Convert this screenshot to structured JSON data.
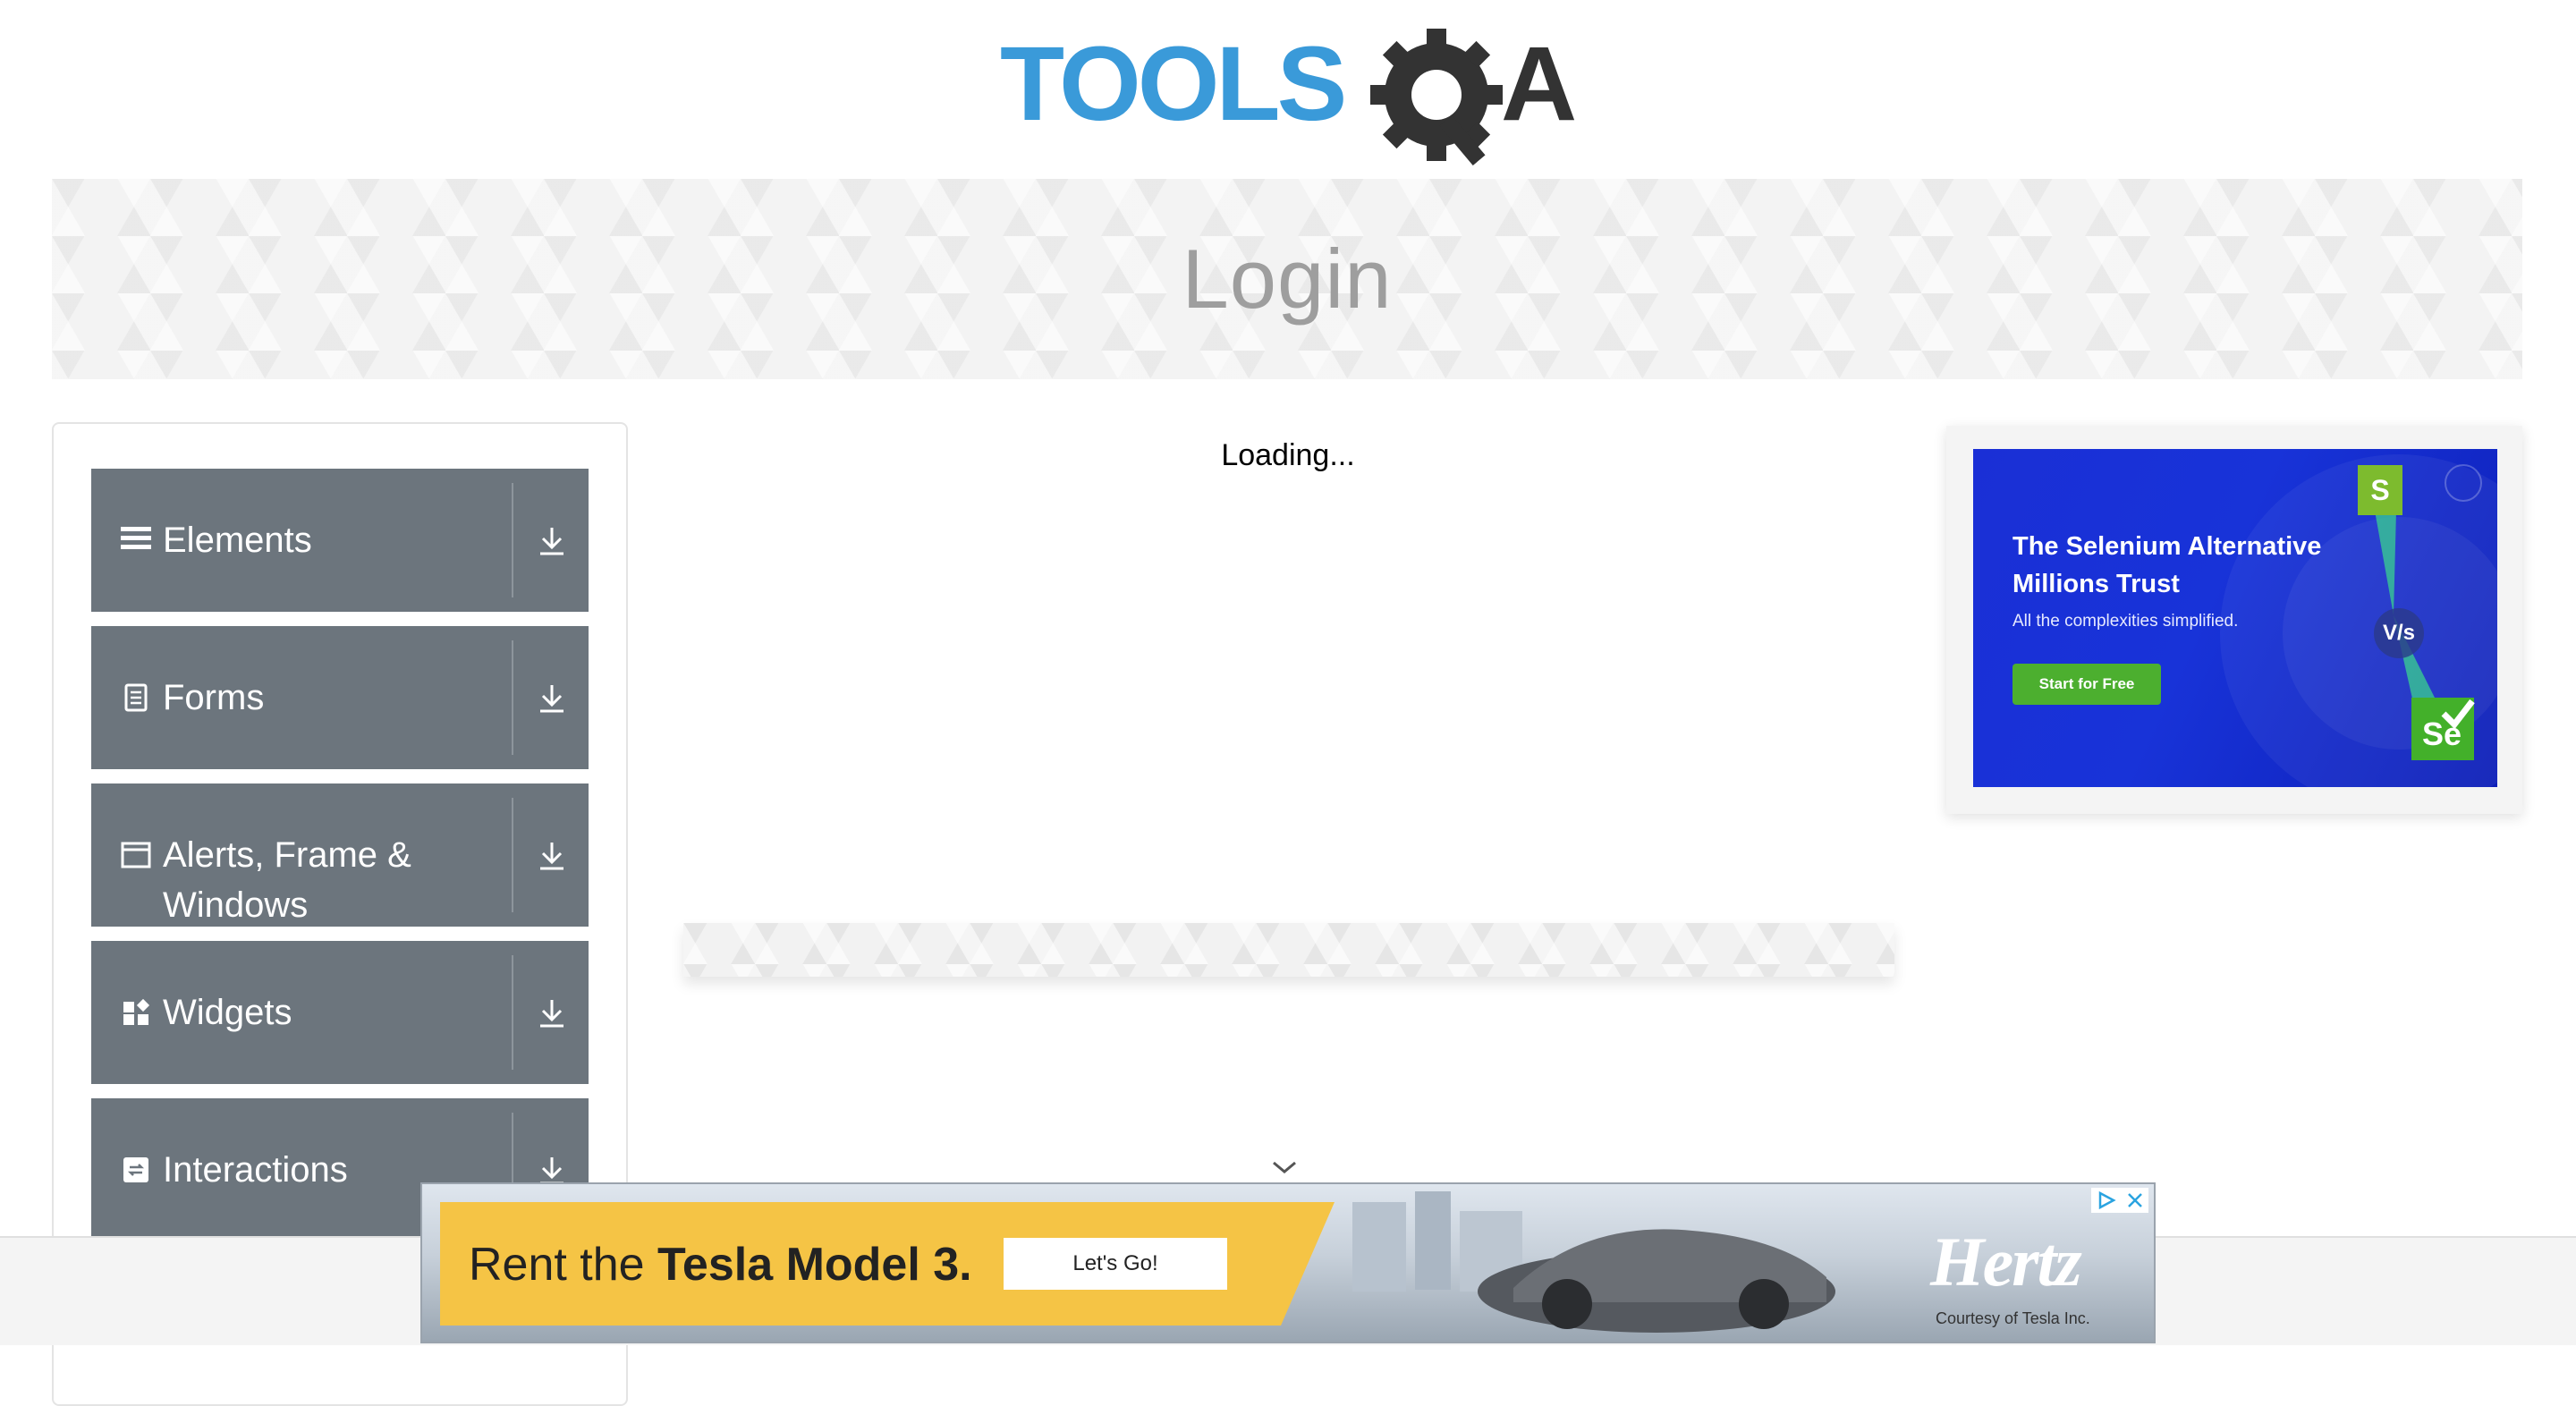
{
  "header": {
    "logo_text_left": "TOOLS",
    "logo_text_right": "A",
    "logo_alt": "TOOLSQA"
  },
  "banner": {
    "title": "Login"
  },
  "sidebar": {
    "groups": [
      {
        "label": "Elements",
        "icon": "menu-lines-icon"
      },
      {
        "label": "Forms",
        "icon": "document-icon"
      },
      {
        "label": "Alerts, Frame & Windows",
        "icon": "window-icon"
      },
      {
        "label": "Widgets",
        "icon": "widgets-icon"
      },
      {
        "label": "Interactions",
        "icon": "interactions-icon"
      }
    ]
  },
  "main": {
    "loading_text": "Loading..."
  },
  "right_ad": {
    "headline": "The Selenium Alternative Millions Trust",
    "subtext": "All the complexities simplified.",
    "cta": "Start for Free",
    "badge_s": "S",
    "badge_vs": "V/s",
    "badge_se": "Se"
  },
  "bottom_ad": {
    "tagline_prefix": "Rent the ",
    "tagline_bold": "Tesla Model 3.",
    "cta": "Let's Go!",
    "brand": "Hertz",
    "courtesy": "Courtesy of Tesla Inc."
  },
  "colors": {
    "sidebar_bg": "#6c757d",
    "logo_blue": "#3a9ad9",
    "logo_dark": "#333333",
    "ad_blue": "#1833d8",
    "ad_cta_green": "#4caf2f",
    "hertz_yellow": "#f5c445"
  }
}
